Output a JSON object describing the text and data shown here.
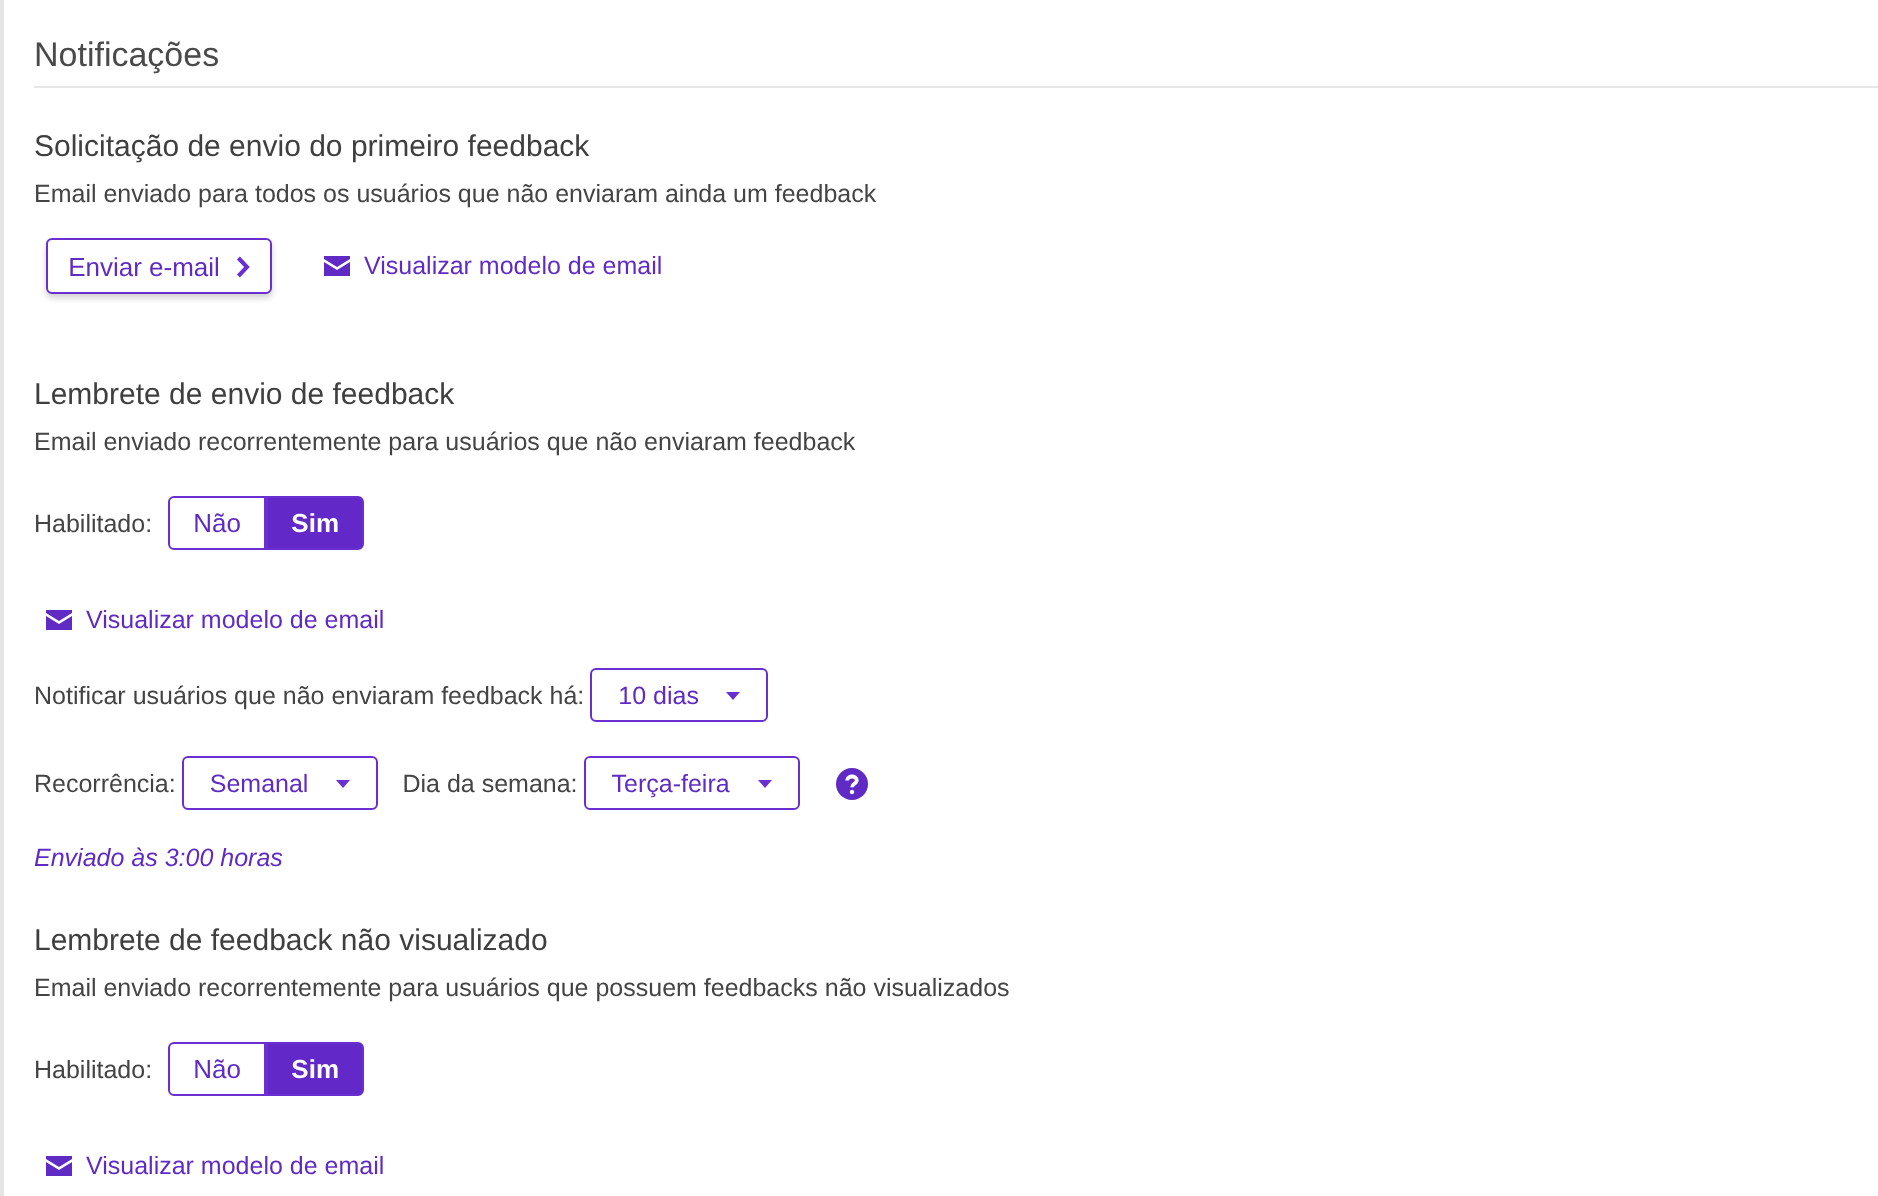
{
  "heading": "Notificações",
  "sections": [
    {
      "title": "Solicitação de envio do primeiro feedback",
      "description": "Email enviado para todos os usuários que não enviaram ainda um feedback",
      "items": [
        {
          "kind": "actions",
          "button": "Enviar e-mail",
          "link": "Visualizar modelo de email"
        }
      ]
    },
    {
      "title": "Lembrete de envio de feedback",
      "description": "Email enviado recorrentemente para usuários que não enviaram feedback",
      "items": [
        {
          "kind": "toggle",
          "label": "Habilitado:",
          "options": [
            {
              "label": "Não",
              "selected": false
            },
            {
              "label": "Sim",
              "selected": true
            }
          ]
        },
        {
          "kind": "link",
          "label": "Visualizar modelo de email"
        },
        {
          "kind": "selects",
          "fields": [
            {
              "label": "Notificar usuários que não enviaram feedback há:",
              "value": "10 dias"
            }
          ]
        },
        {
          "kind": "selects",
          "fields": [
            {
              "label": "Recorrência:",
              "value": "Semanal"
            },
            {
              "label": "Dia da semana:",
              "value": "Terça-feira"
            }
          ],
          "help": true
        },
        {
          "kind": "note",
          "text": "Enviado às 3:00 horas"
        }
      ]
    },
    {
      "title": "Lembrete de feedback não visualizado",
      "description": "Email enviado recorrentemente para usuários que possuem feedbacks não visualizados",
      "items": [
        {
          "kind": "toggle",
          "label": "Habilitado:",
          "options": [
            {
              "label": "Não",
              "selected": false
            },
            {
              "label": "Sim",
              "selected": true
            }
          ]
        },
        {
          "kind": "link",
          "label": "Visualizar modelo de email"
        }
      ]
    }
  ]
}
